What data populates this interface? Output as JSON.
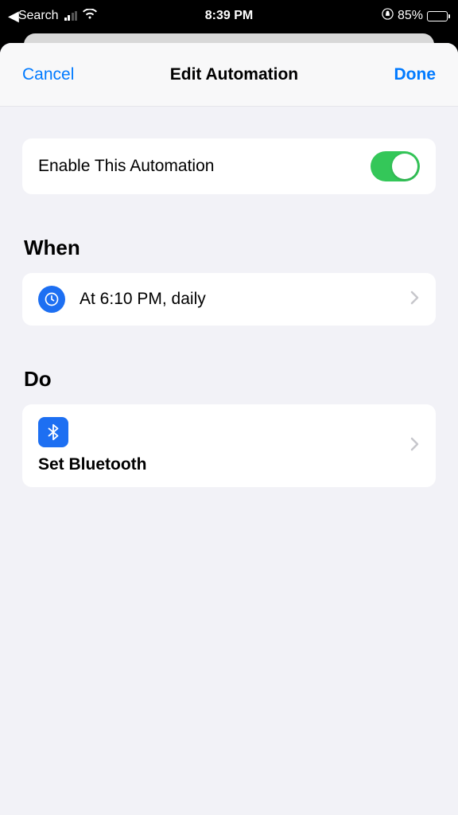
{
  "statusBar": {
    "backApp": "Search",
    "time": "8:39 PM",
    "batteryPercent": "85%"
  },
  "nav": {
    "cancel": "Cancel",
    "title": "Edit Automation",
    "done": "Done"
  },
  "enable": {
    "label": "Enable This Automation",
    "on": true
  },
  "sections": {
    "when": {
      "title": "When",
      "trigger": "At 6:10 PM, daily"
    },
    "do": {
      "title": "Do",
      "action": "Set Bluetooth"
    }
  }
}
